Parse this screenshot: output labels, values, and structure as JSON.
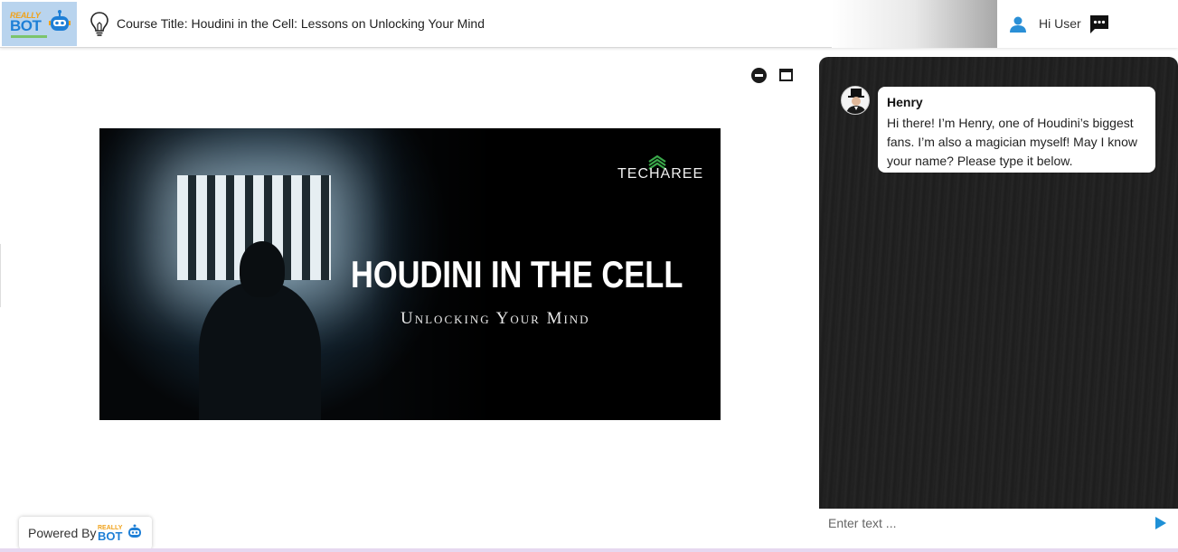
{
  "header": {
    "logo": {
      "line1": "REALLY",
      "line2": "BOT"
    },
    "course_title": "Course Title: Houdini in the Cell: Lessons on Unlocking Your Mind",
    "greeting": "Hi User"
  },
  "icons": {
    "bulb": "lightbulb-icon",
    "user": "user-icon",
    "chat": "chat-bubble-icon",
    "minimize": "minimize-icon",
    "maximize": "maximize-icon",
    "send": "send-icon"
  },
  "banner": {
    "brand": "TECHAREE",
    "title": "HOUDINI IN THE CELL",
    "subtitle": "Unlocking Your Mind"
  },
  "footer": {
    "powered_by": "Powered By",
    "logo": {
      "line1": "REALLY",
      "line2": "BOT"
    }
  },
  "chat": {
    "messages": [
      {
        "sender": "Henry",
        "text": "Hi there! I’m Henry, one of Houdini’s biggest fans. I’m also a magician myself! May I know your name? Please type it below."
      }
    ],
    "input_placeholder": "Enter text ..."
  },
  "colors": {
    "accent_blue": "#1e90d6",
    "chat_bg": "#222222",
    "logo_bg": "#b9d4ee"
  }
}
